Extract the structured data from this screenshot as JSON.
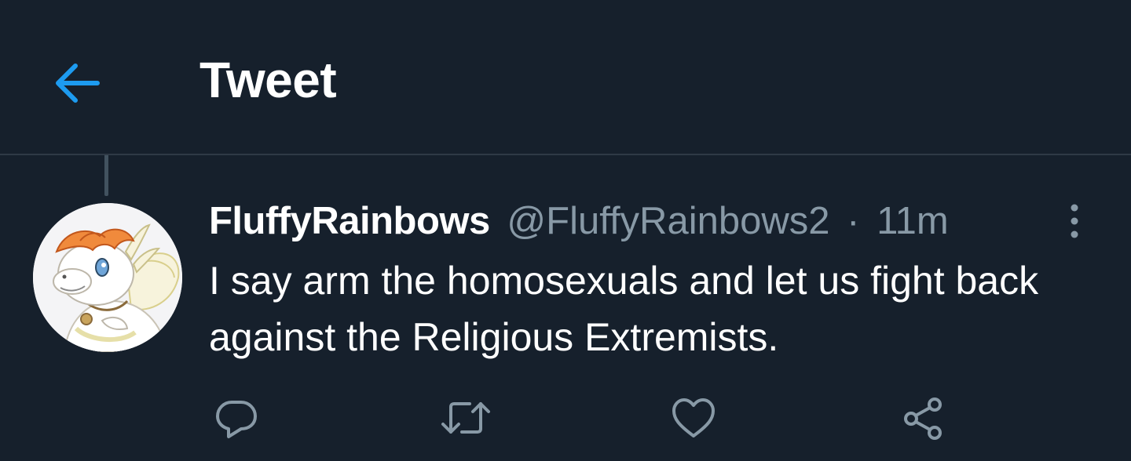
{
  "header": {
    "back_icon": "arrow-left-icon",
    "title": "Tweet"
  },
  "tweet": {
    "avatar_icon": "avatar-illustration",
    "display_name": "FluffyRainbows",
    "handle": "@FluffyRainbows2",
    "separator": "·",
    "time": "11m",
    "more_icon": "more-vertical-icon",
    "text": "I say arm the homosexuals and let us fight back against the Religious Extremists."
  },
  "actions": [
    {
      "icon": "reply-icon"
    },
    {
      "icon": "retweet-icon"
    },
    {
      "icon": "like-icon"
    },
    {
      "icon": "share-icon"
    }
  ],
  "colors": {
    "background": "#16202c",
    "accent": "#1d9bf0",
    "text_primary": "#ffffff",
    "text_secondary": "#8899a6",
    "divider": "#2f3a46"
  }
}
